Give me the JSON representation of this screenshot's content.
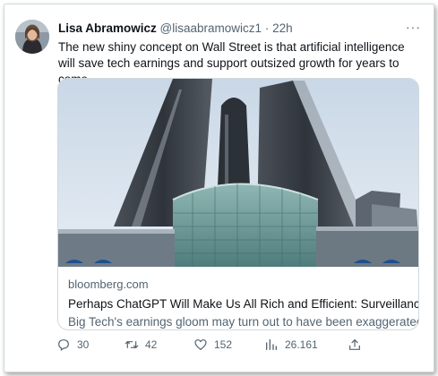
{
  "tweet": {
    "author_name": "Lisa Abramowicz",
    "handle": "@lisaabramowicz1",
    "separator": "·",
    "time": "22h",
    "more_label": "···",
    "text": "The new shiny concept on Wall Street is that artificial intelligence will save tech earnings and support outsized growth for years to come."
  },
  "link_card": {
    "domain": "bloomberg.com",
    "headline": "Perhaps ChatGPT Will Make Us All Rich and Efficient: Surveillance",
    "description": "Big Tech's earnings gloom may turn out to have been exaggerated"
  },
  "actions": {
    "replies": "30",
    "retweets": "42",
    "likes": "152",
    "views": "26.161"
  },
  "icons": {
    "reply": "reply-icon",
    "retweet": "retweet-icon",
    "like": "heart-icon",
    "views": "views-icon",
    "share": "share-icon",
    "more": "more-icon"
  },
  "colors": {
    "text": "#0f1419",
    "muted": "#536471",
    "border": "#cfd9de"
  }
}
